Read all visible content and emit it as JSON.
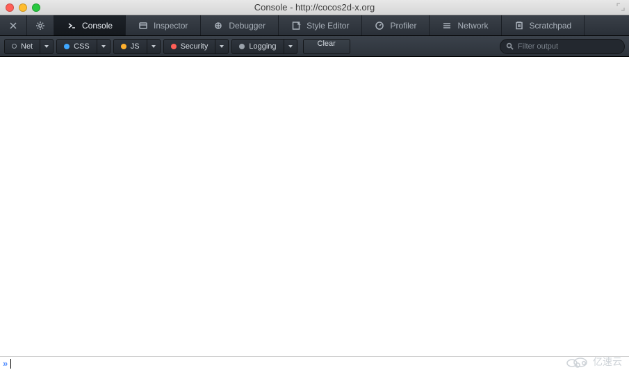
{
  "window": {
    "title": "Console - http://cocos2d-x.org"
  },
  "tabs": {
    "console": {
      "label": "Console",
      "active": true
    },
    "inspector": {
      "label": "Inspector",
      "active": false
    },
    "debugger": {
      "label": "Debugger",
      "active": false
    },
    "style": {
      "label": "Style Editor",
      "active": false
    },
    "profiler": {
      "label": "Profiler",
      "active": false
    },
    "network": {
      "label": "Network",
      "active": false
    },
    "scratch": {
      "label": "Scratchpad",
      "active": false
    }
  },
  "filters": {
    "net": {
      "label": "Net"
    },
    "css": {
      "label": "CSS"
    },
    "js": {
      "label": "JS"
    },
    "security": {
      "label": "Security"
    },
    "logging": {
      "label": "Logging"
    }
  },
  "actions": {
    "clear": "Clear"
  },
  "search": {
    "placeholder": "Filter output",
    "value": ""
  },
  "prompt": {
    "symbol": "»",
    "value": ""
  },
  "watermark": {
    "text": "亿速云"
  }
}
